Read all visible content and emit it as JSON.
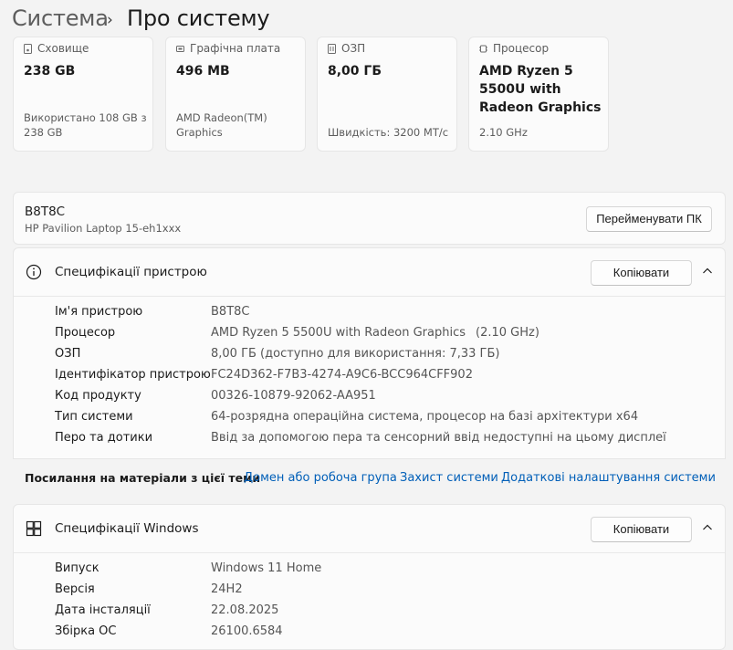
{
  "breadcrumb": {
    "root": "Система",
    "separator": "›",
    "page": "Про систему"
  },
  "tiles": [
    {
      "icon": "storage-icon",
      "title": "Сховище",
      "value": "238 GB",
      "sub": "Використано 108 GB з 238 GB"
    },
    {
      "icon": "gpu-icon",
      "title": "Графічна плата",
      "value": "496 MB",
      "sub": "AMD Radeon(TM) Graphics"
    },
    {
      "icon": "ram-icon",
      "title": "ОЗП",
      "value": "8,00 ГБ",
      "sub": "Швидкість: 3200 MT/с"
    },
    {
      "icon": "cpu-icon",
      "title": "Процесор",
      "value": "AMD Ryzen 5 5500U with Radeon Graphics",
      "sub": "2.10 GHz"
    }
  ],
  "pc": {
    "name": "B8T8C",
    "model": "HP Pavilion Laptop 15-eh1xxx",
    "rename_label": "Перейменувати ПК"
  },
  "device_specs": {
    "title": "Специфікації пристрою",
    "copy_label": "Копіювати",
    "rows": [
      {
        "label": "Ім'я пристрою",
        "value": "B8T8C",
        "extra": ""
      },
      {
        "label": "Процесор",
        "value": "AMD Ryzen 5 5500U with Radeon Graphics",
        "extra": "(2.10 GHz)"
      },
      {
        "label": "ОЗП",
        "value": "8,00 ГБ (доступно для використання: 7,33 ГБ)",
        "extra": ""
      },
      {
        "label": "Ідентифікатор пристрою",
        "value": "FC24D362-F7B3-4274-A9C6-BCC964CFF902",
        "extra": ""
      },
      {
        "label": "Код продукту",
        "value": "00326-10879-92062-AA951",
        "extra": ""
      },
      {
        "label": "Тип системи",
        "value": "64-розрядна операційна система, процесор на базі архітектури x64",
        "extra": ""
      },
      {
        "label": "Перо та дотики",
        "value": "Ввід за допомогою пера та сенсорний ввід недоступні на цьому дисплеї",
        "extra": ""
      }
    ]
  },
  "related": {
    "label": "Посилання на матеріали з цієї теми",
    "links": [
      "Домен або робоча група",
      "Захист системи",
      "Додаткові налаштування системи"
    ]
  },
  "windows_specs": {
    "title": "Специфікації Windows",
    "copy_label": "Копіювати",
    "rows": [
      {
        "label": "Випуск",
        "value": "Windows 11 Home"
      },
      {
        "label": "Версія",
        "value": "24H2"
      },
      {
        "label": "Дата інсталяції",
        "value": "22.08.2025"
      },
      {
        "label": "Збірка ОС",
        "value": "26100.6584"
      }
    ]
  },
  "colors": {
    "accent": "#005fb8",
    "background": "#f3f3f3",
    "card": "#fbfbfb"
  }
}
